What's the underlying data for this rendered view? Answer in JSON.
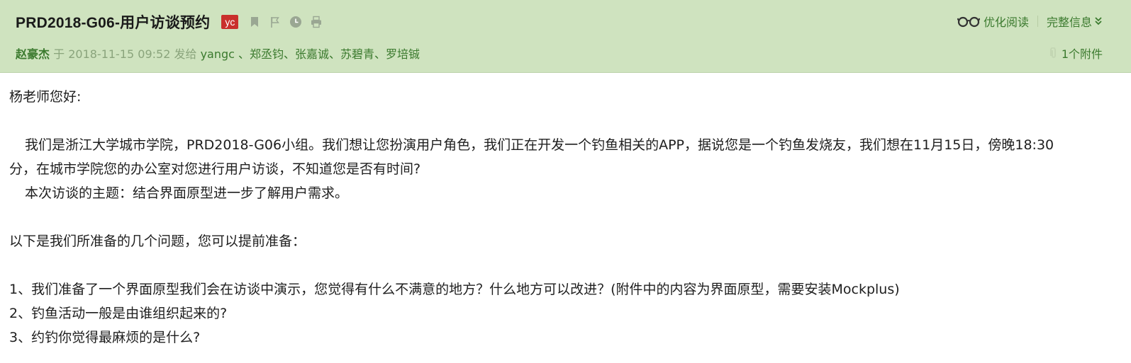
{
  "header": {
    "subject": "PRD2018-G06-用户访谈预约",
    "tag": "yc",
    "tools": {
      "optimize_read": "优化阅读",
      "full_info": "完整信息"
    },
    "meta": {
      "sender": "赵豪杰",
      "at": " 于 ",
      "datetime": "2018-11-15 09:52",
      "sent_to": " 发给 ",
      "recipients": "yangc 、郑丞钧、张嘉诚、苏碧青、罗培铖"
    },
    "attachments": "1个附件"
  },
  "body": {
    "greeting": "杨老师您好:",
    "para1_line1": "我们是浙江大学城市学院，PRD2018-G06小组。我们想让您扮演用户角色，我们正在开发一个钓鱼相关的APP，据说您是一个钓鱼发烧友，我们想在11月15日，傍晚18:30",
    "para1_line2": "分，在城市学院您的办公室对您进行用户访谈，不知道您是否有时间?",
    "para2": "本次访谈的主题：结合界面原型进一步了解用户需求。",
    "intro_questions": "以下是我们所准备的几个问题，您可以提前准备：",
    "questions": [
      "1、我们准备了一个界面原型我们会在访谈中演示，您觉得有什么不满意的地方？什么地方可以改进？(附件中的内容为界面原型，需要安装Mockplus)",
      "2、钓鱼活动一般是由谁组织起来的?",
      "3、约钓你觉得最麻烦的是什么?"
    ]
  },
  "colors": {
    "header_bg": "#cfe3bf",
    "link_green": "#3b7a2e",
    "tag_red": "#c9302c"
  }
}
